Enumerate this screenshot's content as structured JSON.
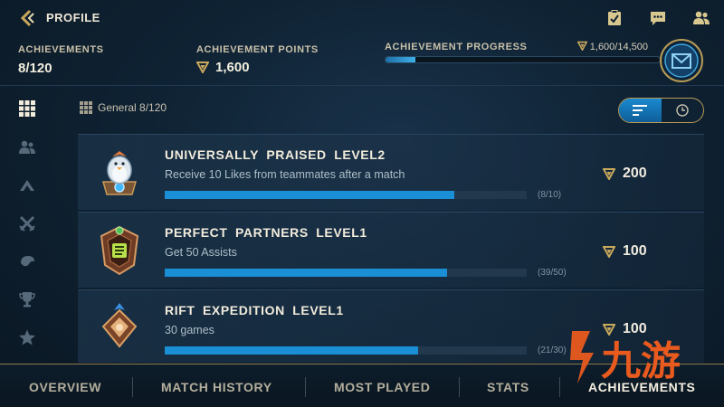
{
  "header": {
    "title": "PROFILE"
  },
  "stats": {
    "achievements_label": "ACHIEVEMENTS",
    "achievements_value": "8/120",
    "points_label": "ACHIEVEMENT POINTS",
    "points_value": "1,600",
    "progress_label": "ACHIEVEMENT PROGRESS",
    "progress_value": "1,600/14,500",
    "progress_fraction": 0.11
  },
  "filter": {
    "category": "General 8/120"
  },
  "achievements": [
    {
      "title": "UNIVERSALLY PRAISED  LEVEL2",
      "desc": "Receive 10 Likes from teammates after a match",
      "count": "(8/10)",
      "fraction": 0.8,
      "reward": "200"
    },
    {
      "title": "PERFECT PARTNERS  LEVEL1",
      "desc": "Get 50 Assists",
      "count": "(39/50)",
      "fraction": 0.78,
      "reward": "100"
    },
    {
      "title": "RIFT EXPEDITION  LEVEL1",
      "desc": "30 games",
      "count": "(21/30)",
      "fraction": 0.7,
      "reward": "100"
    }
  ],
  "nav": {
    "overview": "OVERVIEW",
    "match_history": "MATCH HISTORY",
    "most_played": "MOST PLAYED",
    "stats": "STATS",
    "achievements": "ACHIEVEMENTS"
  },
  "watermark": {
    "text": "九游"
  },
  "colors": {
    "accent_blue": "#1a8fd6",
    "gold": "#c9a95c",
    "watermark_orange": "#e85a1e"
  }
}
